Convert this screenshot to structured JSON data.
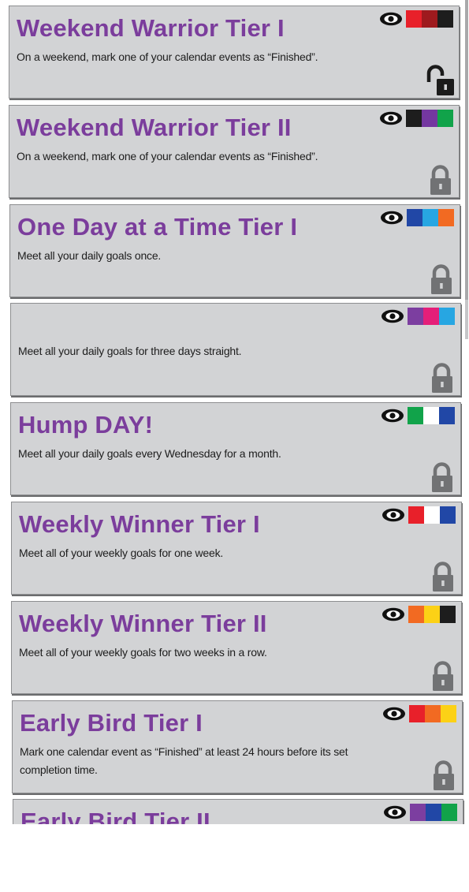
{
  "colors": {
    "title": "#7b3d9c",
    "card_bg": "#d2d3d5",
    "text": "#1d1d1d",
    "lock_grey": "#717274",
    "lock_dark": "#1b1b1b"
  },
  "achievements": [
    {
      "title": "Weekend Warrior Tier I",
      "description": "On a weekend, mark one of your calendar events as “Finished”.",
      "swatches": [
        "#e8202a",
        "#9e1a1e",
        "#1d1d1d"
      ],
      "icon": "unlocked-padlock-icon"
    },
    {
      "title": "Weekend Warrior Tier II",
      "description": "On a weekend, mark one of your calendar events as “Finished”.",
      "swatches": [
        "#1d1d1d",
        "#7437a0",
        "#11a34a"
      ],
      "icon": "padlock-icon"
    },
    {
      "title": "One Day at a Time Tier I",
      "description": "Meet all your daily goals once.",
      "swatches": [
        "#2147a6",
        "#27a6e2",
        "#f26a22"
      ],
      "icon": "padlock-icon"
    },
    {
      "title": "",
      "description": "Meet all your daily goals for three days straight.",
      "swatches": [
        "#7c3ea0",
        "#e51f79",
        "#27a6e2"
      ],
      "icon": "padlock-icon"
    },
    {
      "title": "Hump DAY!",
      "description": "Meet all your daily goals every Wednesday for a month.",
      "swatches": [
        "#11a34a",
        "#ffffff",
        "#2147a6"
      ],
      "icon": "padlock-icon"
    },
    {
      "title": "Weekly Winner Tier I",
      "description": "Meet all of your weekly goals for one week.",
      "swatches": [
        "#e8202a",
        "#ffffff",
        "#2147a6"
      ],
      "icon": "padlock-icon"
    },
    {
      "title": "Weekly Winner Tier II",
      "description": "Meet all of your weekly goals for two weeks in a row.",
      "swatches": [
        "#f26a22",
        "#fcd116",
        "#1d1d1d"
      ],
      "icon": "padlock-icon"
    },
    {
      "title": "Early Bird Tier I",
      "description": "Mark one calendar event as “Finished” at least 24 hours before its set completion time.",
      "swatches": [
        "#e8202a",
        "#f26a22",
        "#fcd116"
      ],
      "icon": "padlock-icon"
    },
    {
      "title": "Early Bird Tier II",
      "description": "",
      "swatches": [
        "#7c3ea0",
        "#2147a6",
        "#11a34a"
      ],
      "icon": "padlock-icon"
    }
  ]
}
